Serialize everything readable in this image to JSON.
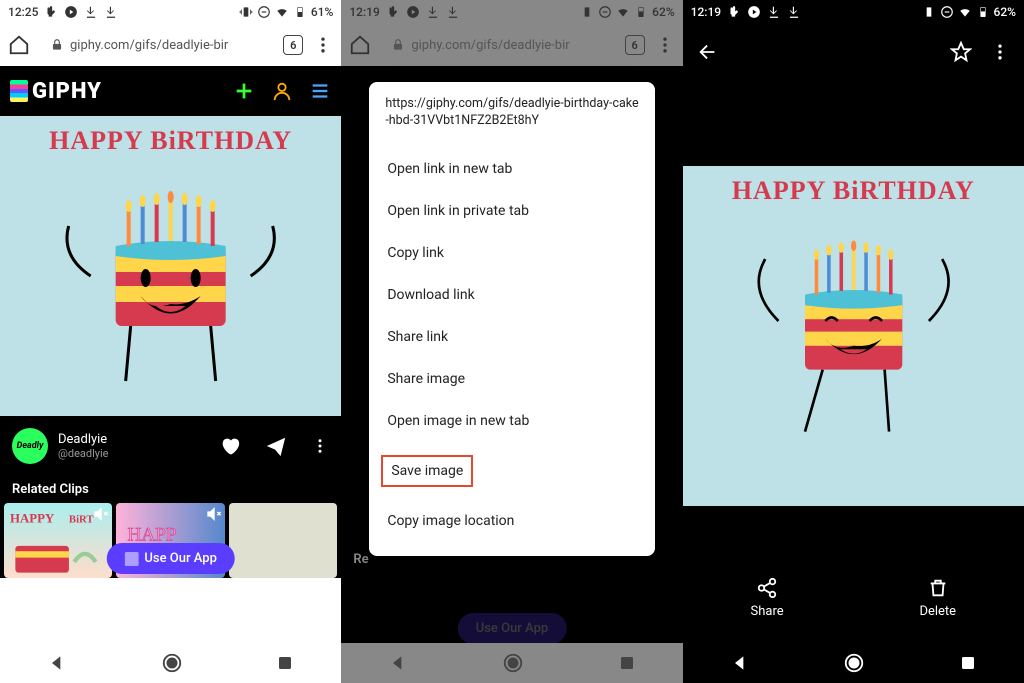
{
  "panel1": {
    "status": {
      "time": "12:25",
      "battery": "61%"
    },
    "browser": {
      "url": "giphy.com/gifs/deadlyie-bir",
      "tab_count": "6"
    },
    "giphy": {
      "brand": "GIPHY"
    },
    "gif": {
      "caption": "HAPPY BiRTHDAY"
    },
    "user": {
      "name": "Deadlyie",
      "handle": "@deadlyie",
      "avatar_label": "Deadly"
    },
    "related_label": "Related Clips",
    "app_pill": "Use Our App"
  },
  "panel2": {
    "status": {
      "time": "12:19",
      "battery": "62%"
    },
    "browser": {
      "url": "giphy.com/gifs/deadlyie-bir",
      "tab_count": "6"
    },
    "related_label": "Re",
    "app_pill": "Use Our App",
    "context": {
      "url": "https://giphy.com/gifs/deadlyie-birthday-cake-hbd-31VVbt1NFZ2B2Et8hY",
      "items": [
        "Open link in new tab",
        "Open link in private tab",
        "Copy link",
        "Download link",
        "Share link",
        "Share image",
        "Open image in new tab",
        "Save image",
        "Copy image location"
      ],
      "highlight_index": 7
    }
  },
  "panel3": {
    "status": {
      "time": "12:19",
      "battery": "62%"
    },
    "gif": {
      "caption": "HAPPY BiRTHDAY"
    },
    "actions": {
      "share": "Share",
      "delete": "Delete"
    }
  }
}
